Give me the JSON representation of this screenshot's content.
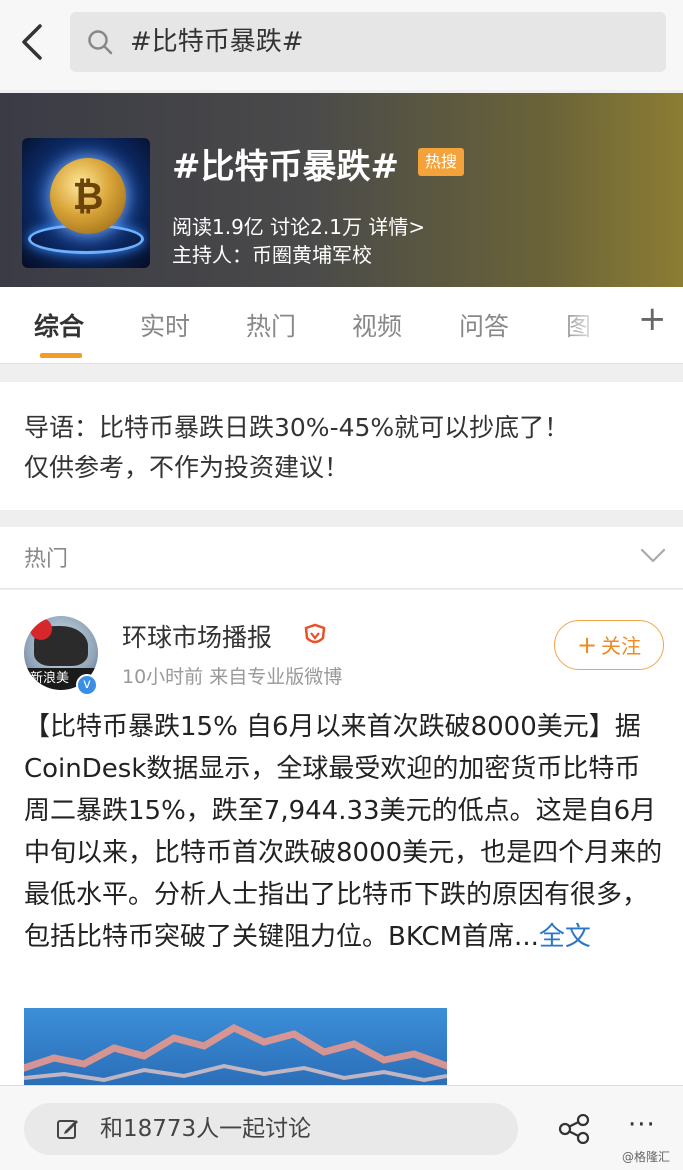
{
  "search": {
    "query": "#比特币暴跌#"
  },
  "banner": {
    "title": "#比特币暴跌#",
    "hot_badge": "热搜",
    "stats": "阅读1.9亿  讨论2.1万  详情>",
    "host": "主持人：币圈黄埔军校"
  },
  "tabs": [
    {
      "label": "综合"
    },
    {
      "label": "实时"
    },
    {
      "label": "热门"
    },
    {
      "label": "视频"
    },
    {
      "label": "问答"
    },
    {
      "label": "图"
    }
  ],
  "intro": {
    "line1": "导语：比特币暴跌日跌30%-45%就可以抄底了！",
    "line2": "仅供参考，不作为投资建议！"
  },
  "section": {
    "label": "热门"
  },
  "post": {
    "avatar_tag": "新浪美",
    "author": "环球市场播报",
    "meta": "10小时前  来自专业版微博",
    "follow_label": "关注",
    "follow_plus": "+",
    "body": "【比特币暴跌15% 自6月以来首次跌破8000美元】据CoinDesk数据显示，全球最受欢迎的加密货币比特币周二暴跌15%，跌至7,944.33美元的低点。这是自6月中旬以来，比特币首次跌破8000美元，也是四个月来的最低水平。分析人士指出了比特币下跌的原因有很多，包括比特币突破了关键阻力位。BKCM首席...",
    "more": "全文"
  },
  "bottom": {
    "comment_placeholder": "和18773人一起讨论",
    "more_dots": "···",
    "watermark": "@格隆汇"
  },
  "colors": {
    "accent": "#f39c26",
    "link": "#2d75c7",
    "hot_badge": "#f4a33a"
  }
}
